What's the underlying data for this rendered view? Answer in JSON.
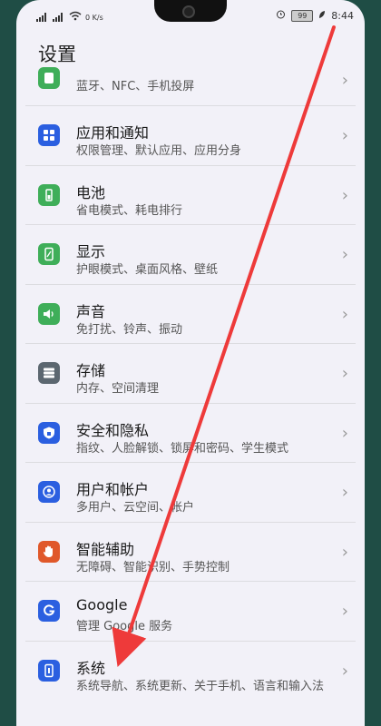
{
  "status": {
    "carrier_left": "4G",
    "speed": "0 K/s",
    "battery": "99",
    "time": "8:44"
  },
  "page": {
    "title": "设置"
  },
  "items": [
    {
      "name": "",
      "sub": "蓝牙、NFC、手机投屏",
      "color": "#3fae59",
      "icon": "device-connection-icon"
    },
    {
      "name": "应用和通知",
      "sub": "权限管理、默认应用、应用分身",
      "color": "#2b5fe0",
      "icon": "apps-icon"
    },
    {
      "name": "电池",
      "sub": "省电模式、耗电排行",
      "color": "#3fae59",
      "icon": "battery-icon"
    },
    {
      "name": "显示",
      "sub": "护眼模式、桌面风格、壁纸",
      "color": "#3fae59",
      "icon": "display-icon"
    },
    {
      "name": "声音",
      "sub": "免打扰、铃声、振动",
      "color": "#3fae59",
      "icon": "sound-icon"
    },
    {
      "name": "存储",
      "sub": "内存、空间清理",
      "color": "#5c6770",
      "icon": "storage-icon"
    },
    {
      "name": "安全和隐私",
      "sub": "指纹、人脸解锁、锁屏和密码、学生模式",
      "color": "#2b5fe0",
      "icon": "security-icon"
    },
    {
      "name": "用户和帐户",
      "sub": "多用户、云空间、帐户",
      "color": "#2b5fe0",
      "icon": "user-icon"
    },
    {
      "name": "智能辅助",
      "sub": "无障碍、智能识别、手势控制",
      "color": "#e0582a",
      "icon": "hand-icon"
    },
    {
      "name": "Google",
      "sub": "管理 Google 服务",
      "color": "#2b5fe0",
      "icon": "google-icon"
    },
    {
      "name": "系统",
      "sub": "系统导航、系统更新、关于手机、语言和输入法",
      "color": "#2b5fe0",
      "icon": "system-icon"
    }
  ],
  "annotation": {
    "arrow_color": "#ee3a3a"
  }
}
